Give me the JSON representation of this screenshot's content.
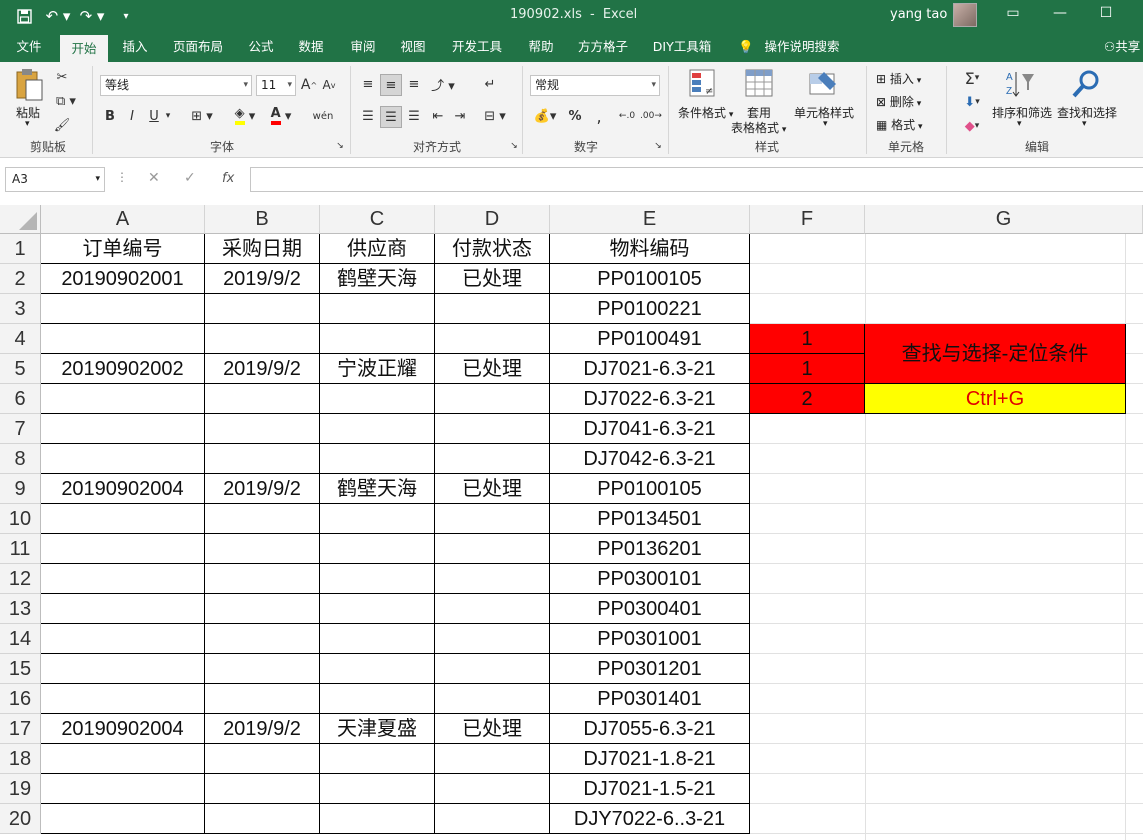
{
  "window": {
    "file_title": "190902.xls",
    "app_name": "Excel",
    "title_separator": "-",
    "user_name": "yang tao"
  },
  "ribbon_tabs": [
    {
      "label": "文件",
      "active": false
    },
    {
      "label": "开始",
      "active": true
    },
    {
      "label": "插入",
      "active": false
    },
    {
      "label": "页面布局",
      "active": false
    },
    {
      "label": "公式",
      "active": false
    },
    {
      "label": "数据",
      "active": false
    },
    {
      "label": "审阅",
      "active": false
    },
    {
      "label": "视图",
      "active": false
    },
    {
      "label": "开发工具",
      "active": false
    },
    {
      "label": "帮助",
      "active": false
    },
    {
      "label": "方方格子",
      "active": false
    },
    {
      "label": "DIY工具箱",
      "active": false
    }
  ],
  "tell_me": "操作说明搜索",
  "share_label": "共享",
  "ribbon": {
    "paste_label": "粘贴",
    "clipboard_group": "剪贴板",
    "font_name": "等线",
    "font_size": "11",
    "font_group": "字体",
    "bold": "B",
    "italic": "I",
    "underline": "U",
    "font_color_letter": "A",
    "phonetic_label": "wén",
    "alignment_group": "对齐方式",
    "number_format": "常规",
    "number_group": "数字",
    "cond_format": "条件格式",
    "table_format_line1": "套用",
    "table_format_line2": "表格格式",
    "cell_styles": "单元格样式",
    "styles_group": "样式",
    "insert_label": "插入",
    "delete_label": "删除",
    "format_label": "格式",
    "cells_group": "单元格",
    "sort_filter": "排序和筛选",
    "find_select": "查找和选择",
    "editing_group": "编辑"
  },
  "formula_bar": {
    "name_box": "A3",
    "fx": "fx",
    "content": ""
  },
  "columns": [
    "A",
    "B",
    "C",
    "D",
    "E",
    "F",
    "G"
  ],
  "rows": [
    "1",
    "2",
    "3",
    "4",
    "5",
    "6",
    "7",
    "8",
    "9",
    "10",
    "11",
    "12",
    "13",
    "14",
    "15",
    "16",
    "17",
    "18",
    "19",
    "20"
  ],
  "table": {
    "headers": [
      "订单编号",
      "采购日期",
      "供应商",
      "付款状态",
      "物料编码"
    ],
    "rows": [
      [
        "20190902001",
        "2019/9/2",
        "鹤壁天海",
        "已处理",
        "PP0100105"
      ],
      [
        "",
        "",
        "",
        "",
        "PP0100221"
      ],
      [
        "",
        "",
        "",
        "",
        "PP0100491"
      ],
      [
        "20190902002",
        "2019/9/2",
        "宁波正耀",
        "已处理",
        "DJ7021-6.3-21"
      ],
      [
        "",
        "",
        "",
        "",
        "DJ7022-6.3-21"
      ],
      [
        "",
        "",
        "",
        "",
        "DJ7041-6.3-21"
      ],
      [
        "",
        "",
        "",
        "",
        "DJ7042-6.3-21"
      ],
      [
        "20190902004",
        "2019/9/2",
        "鹤壁天海",
        "已处理",
        "PP0100105"
      ],
      [
        "",
        "",
        "",
        "",
        "PP0134501"
      ],
      [
        "",
        "",
        "",
        "",
        "PP0136201"
      ],
      [
        "",
        "",
        "",
        "",
        "PP0300101"
      ],
      [
        "",
        "",
        "",
        "",
        "PP0300401"
      ],
      [
        "",
        "",
        "",
        "",
        "PP0301001"
      ],
      [
        "",
        "",
        "",
        "",
        "PP0301201"
      ],
      [
        "",
        "",
        "",
        "",
        "PP0301401"
      ],
      [
        "20190902004",
        "2019/9/2",
        "天津夏盛",
        "已处理",
        "DJ7055-6.3-21"
      ],
      [
        "",
        "",
        "",
        "",
        "DJ7021-1.8-21"
      ],
      [
        "",
        "",
        "",
        "",
        "DJ7021-1.5-21"
      ],
      [
        "",
        "",
        "",
        "",
        "DJY7022-6..3-21"
      ]
    ]
  },
  "side_notes": {
    "f4": "1",
    "f5": "1",
    "f6": "2",
    "g45": "查找与选择-定位条件",
    "g6": "Ctrl+G"
  },
  "colors": {
    "excel_green": "#217346",
    "note_red": "#ff0000",
    "note_yellow": "#ffff00",
    "note_text_red": "#e00000"
  }
}
